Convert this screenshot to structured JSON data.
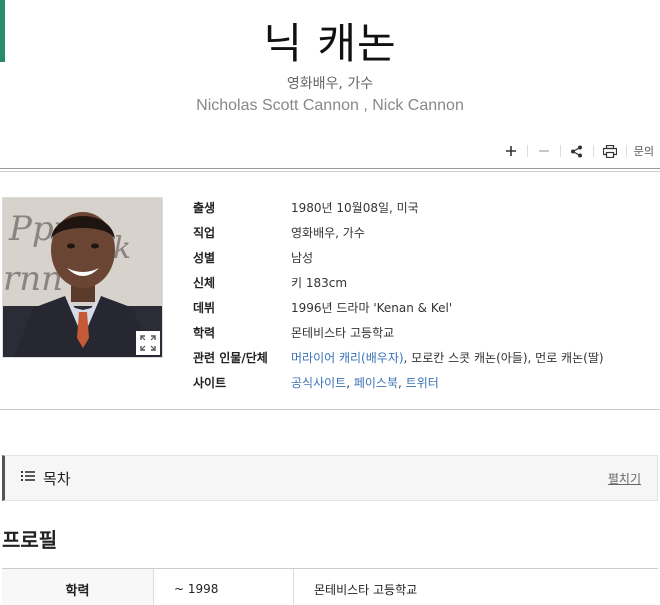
{
  "header": {
    "title": "닉 캐논",
    "subtitle": "영화배우, 가수",
    "english_name": "Nicholas Scott Cannon , Nick Cannon",
    "accent_color": "#2a8a6e"
  },
  "toolbar": {
    "zoom_in_icon": "plus-icon",
    "zoom_out_icon": "minus-icon",
    "share_icon": "share-icon",
    "print_icon": "printer-icon",
    "inquiry_label": "문의"
  },
  "profile": {
    "photo_icon": "expand-icon",
    "rows": [
      {
        "label": "출생",
        "value": "1980년 10월08일, 미국"
      },
      {
        "label": "직업",
        "value": "영화배우, 가수"
      },
      {
        "label": "성별",
        "value": "남성"
      },
      {
        "label": "신체",
        "value": "키 183cm"
      },
      {
        "label": "데뷔",
        "value": "1996년 드라마 'Kenan & Kel'"
      },
      {
        "label": "학력",
        "value": "몬테비스타 고등학교"
      }
    ],
    "related": {
      "label": "관련 인물/단체",
      "link1": "머라이어 캐리(배우자)",
      "rest": ", 모로칸 스콧 캐논(아들), 먼로 캐논(딸)"
    },
    "sites": {
      "label": "사이트",
      "link1": "공식사이트",
      "sep1": ", ",
      "link2": "페이스북",
      "sep2": ", ",
      "link3": "트위터"
    },
    "link_color": "#3a73b8"
  },
  "toc": {
    "icon": "list-icon",
    "label": "목차",
    "toggle": "펼치기"
  },
  "section": {
    "title": "프로필",
    "education": {
      "label": "학력",
      "period": "~ 1998",
      "school": "몬테비스타 고등학교"
    }
  }
}
